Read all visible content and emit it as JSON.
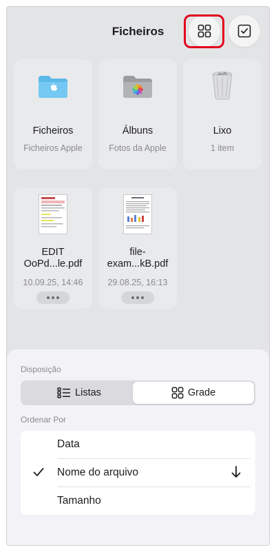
{
  "header": {
    "title": "Ficheiros",
    "grid_button_icon": "grid-icon",
    "select_button_icon": "checkbox-icon"
  },
  "tiles": [
    {
      "name": "Ficheiros",
      "subtitle": "Ficheiros Apple",
      "icon": "folder-icon",
      "color": "#6ac4f0"
    },
    {
      "name": "Álbuns",
      "subtitle": "Fotos da Apple",
      "icon": "photos-folder-icon",
      "color": "#a9aaae"
    },
    {
      "name": "Lixo",
      "subtitle": "1 item",
      "icon": "trash-icon",
      "color": "#c9cacc"
    }
  ],
  "files": [
    {
      "name_line1": "EDIT",
      "name_line2": "OoPd...le.pdf",
      "date": "10.09.25, 14:46"
    },
    {
      "name_line1": "file-",
      "name_line2": "exam...kB.pdf",
      "date": "29.08.25, 16:13"
    }
  ],
  "sheet": {
    "layout_label": "Disposição",
    "layout_options": {
      "lists": "Listas",
      "grid": "Grade"
    },
    "selected_layout": "Grade",
    "sort_label": "Ordenar Por",
    "sort_options": [
      "Data",
      "Nome do arquivo",
      "Tamanho"
    ],
    "selected_sort": "Nome do arquivo",
    "sort_direction": "descending"
  },
  "colors": {
    "highlight": "#e3001b",
    "background": "#e3e4e6",
    "sheet": "#f2f2f7"
  }
}
